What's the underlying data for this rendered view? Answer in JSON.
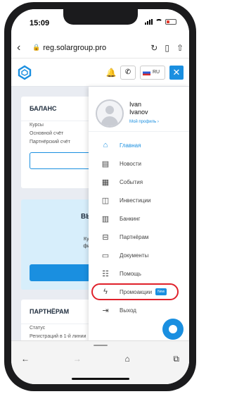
{
  "status": {
    "time": "15:09"
  },
  "browser": {
    "url": "reg.solargroup.pro"
  },
  "header": {
    "lang": "RU"
  },
  "balance": {
    "title": "БАЛАНС",
    "rows": [
      "Курсы",
      "Основной счёт",
      "Партнёрский счёт"
    ],
    "button": "П"
  },
  "invest": {
    "title_line1": "ВЫ ЕЩЕ НЕ С",
    "title_line2": "ИНВЕСТИ",
    "text_line1": "Купите инвестицио",
    "text_line2": "финансирования, ч",
    "text_line3": "доли на са",
    "button": "Выбрать"
  },
  "partners": {
    "title": "ПАРТНЁРАМ",
    "rows": [
      "Статус",
      "Регистраций в 1-й линии"
    ],
    "count": "4"
  },
  "profile": {
    "first_name": "Ivan",
    "last_name": "Ivanov",
    "link": "Мой профиль ›"
  },
  "menu": [
    {
      "label": "Главная",
      "icon": "home-icon"
    },
    {
      "label": "Новости",
      "icon": "newspaper-icon"
    },
    {
      "label": "События",
      "icon": "calendar-icon"
    },
    {
      "label": "Инвестиции",
      "icon": "investments-icon"
    },
    {
      "label": "Банкинг",
      "icon": "bank-icon"
    },
    {
      "label": "Партнёрам",
      "icon": "partners-icon"
    },
    {
      "label": "Документы",
      "icon": "document-icon"
    },
    {
      "label": "Помощь",
      "icon": "help-icon"
    },
    {
      "label": "Промоакции",
      "icon": "lightning-icon",
      "badge": "New"
    },
    {
      "label": "Выход",
      "icon": "logout-icon"
    }
  ],
  "colors": {
    "accent": "#1a8fe0",
    "highlight": "#e0212b"
  }
}
